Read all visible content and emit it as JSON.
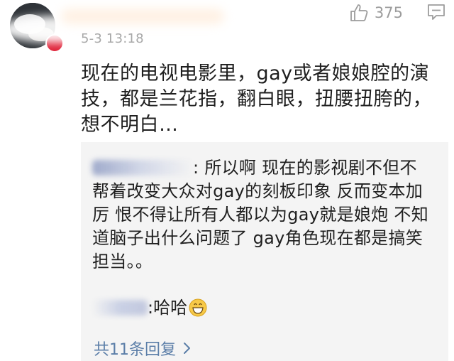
{
  "comment": {
    "timestamp": "5-3 13:18",
    "like_count": "375",
    "text": "现在的电视电影里，gay或者娘娘腔的演技，都是兰花指，翻白眼，扭腰扭胯的，想不明白…"
  },
  "replies": [
    {
      "text": ": 所以啊 现在的影视剧不但不帮着改变大众对gay的刻板印象 反而变本加厉 恨不得让所有人都以为gay就是娘炮 不知道脑子出什么问题了 gay角色现在都是搞笑担当。。"
    },
    {
      "text": ":哈哈"
    }
  ],
  "more_replies_label": "共11条回复",
  "icons": {
    "like": "thumbs-up-icon",
    "reply": "reply-icon",
    "chevron": "chevron-right-icon",
    "emoji": "grinning-emoji"
  },
  "colors": {
    "link": "#5b7ea8",
    "meta": "#a8a8a8",
    "reply_bg": "#f4f4f4"
  }
}
